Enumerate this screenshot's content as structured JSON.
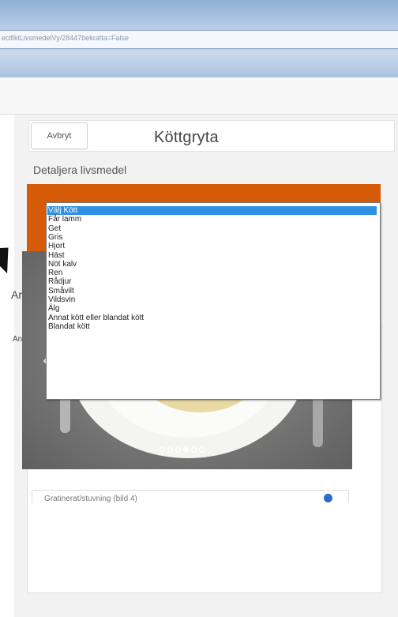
{
  "browser": {
    "url": "ecifiktLivsmedelVy/28447bekrafta=False"
  },
  "header": {
    "cancel_label": "Avbryt",
    "title": "Köttgryta"
  },
  "section": {
    "label": "Detaljera livsmedel"
  },
  "partial_labels": {
    "left_heading": "Ar",
    "left_select": "An"
  },
  "dropdown": {
    "selected_index": 0,
    "options": [
      "Välj Kött",
      "Får lamm",
      "Get",
      "Gris",
      "Hjort",
      "Häst",
      "Nöt kalv",
      "Ren",
      "Rådjur",
      "Småvilt",
      "Vildsvin",
      "Älg",
      "Annat kött eller blandat kött",
      "Blandat kött"
    ]
  },
  "carousel": {
    "prev_icon": "chevron-left-icon",
    "next_icon": "chevron-right-icon",
    "dot_count": 5,
    "active_dot": 3
  },
  "bottom": {
    "text": "Gratinerat/stuvning (bild 4)"
  },
  "colors": {
    "accent": "#d65b08",
    "selection": "#2f8fe0",
    "check": "#2a6dc7"
  }
}
